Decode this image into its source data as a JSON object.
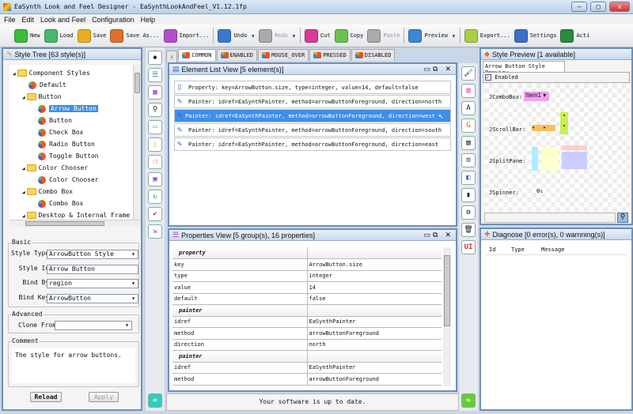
{
  "window": {
    "title": "EaSynth Look and Feel Designer - EaSynthLookAndFeel_V1.12.1fp"
  },
  "menu": [
    "File",
    "Edit",
    "Look and Feel",
    "Configuration",
    "Help"
  ],
  "toolbar": [
    {
      "label": "New",
      "color": "#3dbb3d",
      "icon": "plus"
    },
    {
      "label": "Load",
      "color": "#48b86a",
      "icon": "folder"
    },
    {
      "label": "Save",
      "color": "#e8b020",
      "icon": "save"
    },
    {
      "label": "Save As...",
      "color": "#e0702a",
      "icon": "save-as"
    },
    {
      "label": "Import...",
      "color": "#b050c8",
      "icon": "import"
    },
    {
      "label": "Undo",
      "color": "#3a78d0",
      "icon": "undo"
    },
    {
      "label": "Redo",
      "color": "#aaaaaa",
      "icon": "redo",
      "disabled": true
    },
    {
      "label": "Cut",
      "color": "#d83a9a",
      "icon": "cut"
    },
    {
      "label": "Copy",
      "color": "#6cc050",
      "icon": "copy"
    },
    {
      "label": "Paste",
      "color": "#aaaaaa",
      "icon": "paste",
      "disabled": true
    },
    {
      "label": "Preview",
      "color": "#3a88d8",
      "icon": "preview"
    },
    {
      "label": "Export...",
      "color": "#a8d040",
      "icon": "export"
    },
    {
      "label": "Settings",
      "color": "#3a70c8",
      "icon": "settings"
    },
    {
      "label": "Acti",
      "color": "#2a8a3a",
      "icon": "action"
    }
  ],
  "style_tree": {
    "title": "Style Tree [63 style(s)]",
    "items": [
      {
        "label": "Component Styles",
        "type": "folder",
        "level": 0
      },
      {
        "label": "Default",
        "type": "style",
        "level": 1
      },
      {
        "label": "Button",
        "type": "folder",
        "level": 1
      },
      {
        "label": "Arrow Button",
        "type": "style",
        "level": 2,
        "selected": true
      },
      {
        "label": "Button",
        "type": "style",
        "level": 2
      },
      {
        "label": "Check Box",
        "type": "style",
        "level": 2
      },
      {
        "label": "Radio Button",
        "type": "style",
        "level": 2
      },
      {
        "label": "Toggle Button",
        "type": "style",
        "level": 2
      },
      {
        "label": "Color Chooser",
        "type": "folder",
        "level": 1
      },
      {
        "label": "Color Chooser",
        "type": "style",
        "level": 2
      },
      {
        "label": "Combo Box",
        "type": "folder",
        "level": 1
      },
      {
        "label": "Combo Box",
        "type": "style",
        "level": 2
      },
      {
        "label": "Desktop & Internal Frame",
        "type": "folder",
        "level": 1
      }
    ]
  },
  "form": {
    "basic_label": "Basic",
    "style_type_label": "Style Type:",
    "style_type": "ArrowButton Style",
    "style_id_label": "Style Id:",
    "style_id": "Arrow Button",
    "bind_by_label": "Bind By:",
    "bind_by": "region",
    "bind_key_label": "Bind Key:",
    "bind_key": "ArrowButton",
    "advanced_label": "Advanced",
    "clone_from_label": "Clone From:",
    "clone_from": "",
    "comment_label": "Comment",
    "comment": "The style for arrow buttons.",
    "reload": "Reload",
    "apply": "Apply"
  },
  "state_tabs": [
    "COMMON",
    "ENABLED",
    "MOUSE_OVER",
    "PRESSED",
    "DISABLED"
  ],
  "element_list": {
    "title": "Element List View [5 element(s)]",
    "items": [
      {
        "kind": "Property:",
        "text": "key=ArrowButton.size, type=integer, value=14, default=false"
      },
      {
        "kind": "Painter:",
        "text": "idref=EaSynthPainter, method=arrowButtonForeground, direction=north"
      },
      {
        "kind": "Painter:",
        "text": "idref=EaSynthPainter, method=arrowButtonForeground, direction=west",
        "selected": true
      },
      {
        "kind": "Painter:",
        "text": "idref=EaSynthPainter, method=arrowButtonForeground, direction=south"
      },
      {
        "kind": "Painter:",
        "text": "idref=EaSynthPainter, method=arrowButtonForeground, direction=east"
      }
    ]
  },
  "properties": {
    "title": "Properties View [5 group(s), 16 properties]",
    "rows": [
      {
        "group": "property"
      },
      {
        "k": "key",
        "v": "ArrowButton.size"
      },
      {
        "k": "type",
        "v": "integer"
      },
      {
        "k": "value",
        "v": "14"
      },
      {
        "k": "default",
        "v": "false"
      },
      {
        "group": "painter"
      },
      {
        "k": "idref",
        "v": "EaSynthPainter"
      },
      {
        "k": "method",
        "v": "arrowButtonForeground"
      },
      {
        "k": "direction",
        "v": "north"
      },
      {
        "group": "painter"
      },
      {
        "k": "idref",
        "v": "EaSynthPainter"
      },
      {
        "k": "method",
        "v": "arrowButtonForeground"
      }
    ]
  },
  "status": "Your software is up to date.",
  "preview": {
    "title": "Style Preview [1 available]",
    "tab": "Arrow Button Style Preview",
    "enabled": "Enabled",
    "combo_label": "JComboBox:",
    "combo_value": "Item1",
    "scroll_label": "JScrollBar:",
    "split_label": "JSplitPane:",
    "spinner_label": "JSpinner:",
    "spinner_value": "0"
  },
  "diagnose": {
    "title": "Diagnose [0 error(s), 0 warnning(s)]",
    "columns": [
      "Id",
      "Type",
      "Message"
    ]
  }
}
